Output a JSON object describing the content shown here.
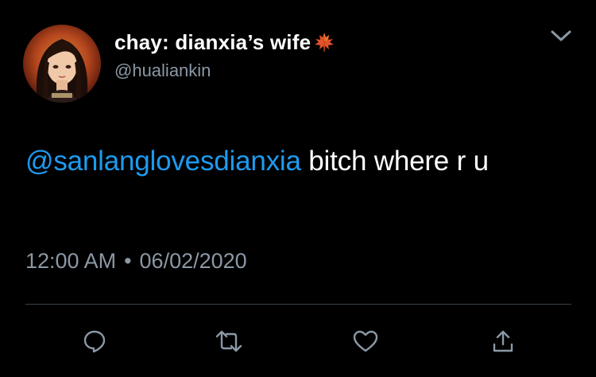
{
  "tweet": {
    "display_name": "chay: dianxia’s wife",
    "display_name_emoji_icon": "maple-leaf-icon",
    "handle": "@hualiankin",
    "mention": "@sanlanglovesdianxia",
    "text_after_mention": " bitch where r u",
    "time": "12:00 AM",
    "separator": "•",
    "date": "06/02/2020"
  },
  "actions": [
    {
      "name": "reply",
      "icon": "reply-icon"
    },
    {
      "name": "retweet",
      "icon": "retweet-icon"
    },
    {
      "name": "like",
      "icon": "heart-icon"
    },
    {
      "name": "share",
      "icon": "share-icon"
    }
  ],
  "colors": {
    "background": "#000000",
    "text": "#ffffff",
    "secondary_text": "#8b98a5",
    "link": "#1d9bf0",
    "divider": "#38444d",
    "icon": "#8b98a5"
  }
}
